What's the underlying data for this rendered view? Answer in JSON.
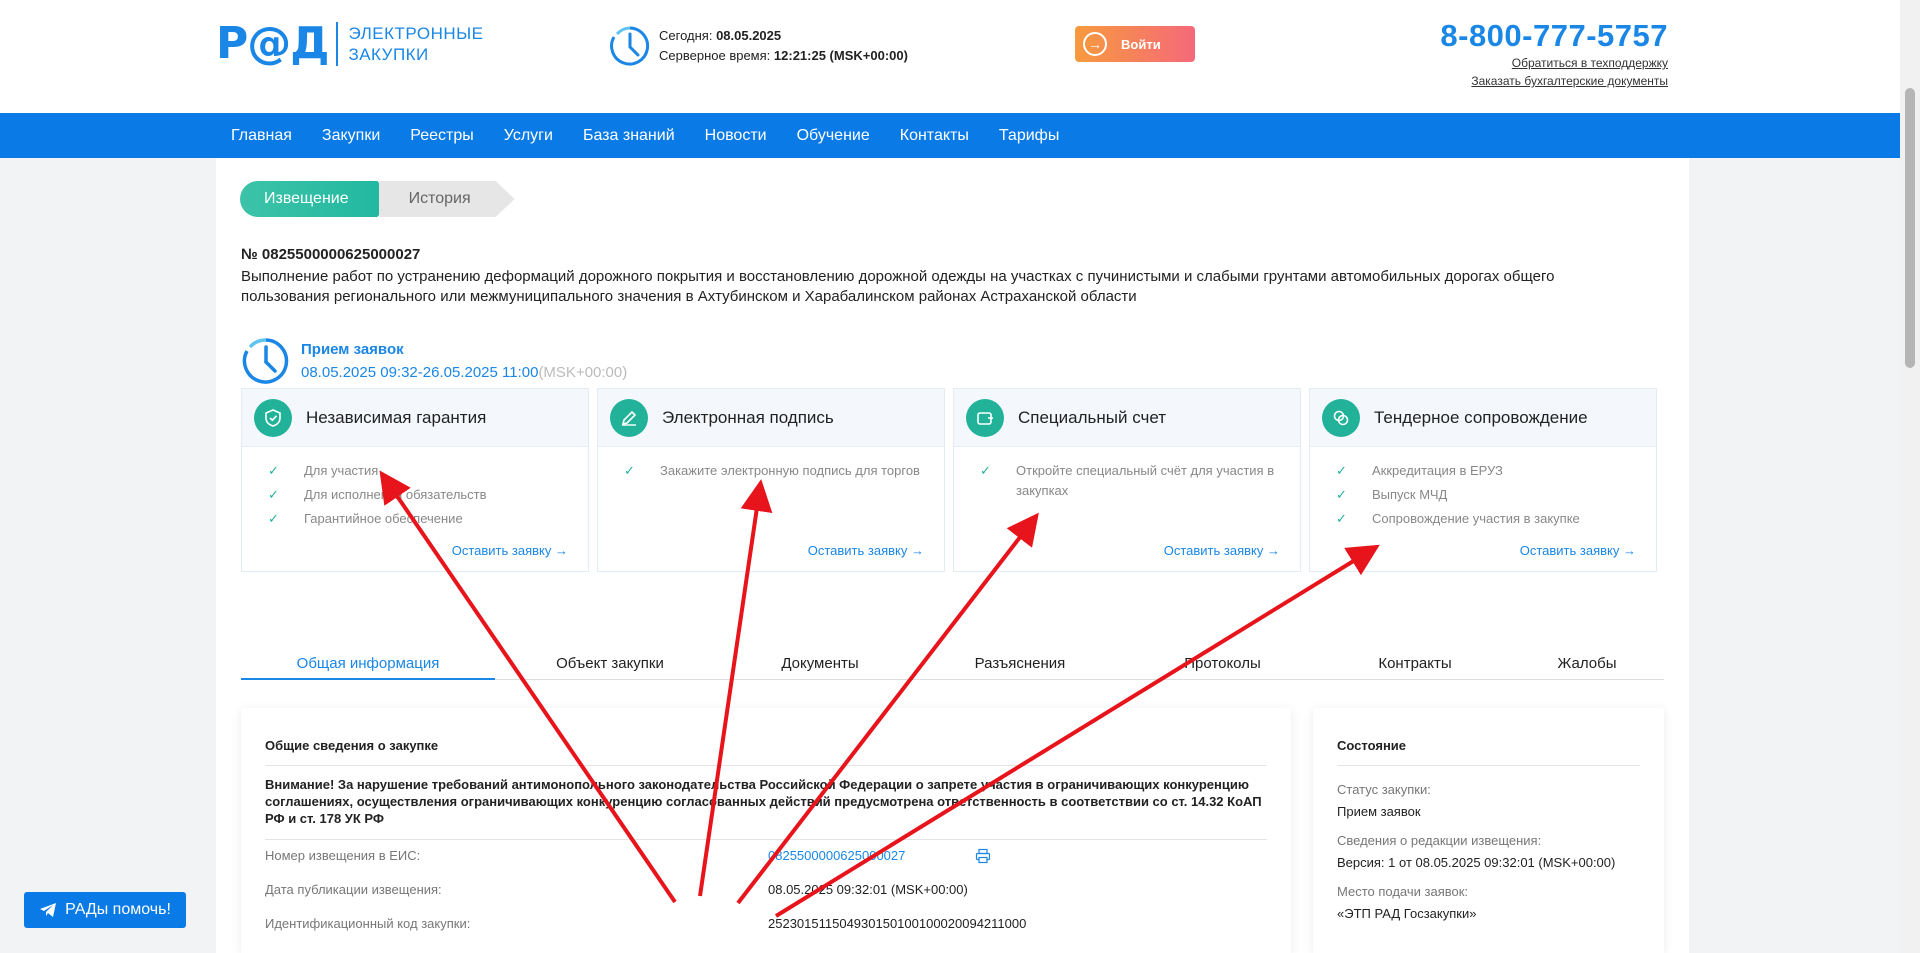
{
  "header": {
    "logo_mark": "Р@Д",
    "logo_line1": "ЭЛЕКТРОННЫЕ",
    "logo_line2": "ЗАКУПКИ",
    "today_label": "Сегодня:",
    "today_value": "08.05.2025",
    "server_label": "Серверное время:",
    "server_value": "12:21:25 (MSK+00:00)",
    "login_label": "Войти",
    "phone": "8-800-777-5757",
    "support_link": "Обратиться в техподдержку",
    "docs_link": "Заказать бухгалтерские документы"
  },
  "nav": {
    "items": [
      "Главная",
      "Закупки",
      "Реестры",
      "Услуги",
      "База знаний",
      "Новости",
      "Обучение",
      "Контакты",
      "Тарифы"
    ]
  },
  "tabs": {
    "active": "Извещение",
    "inactive": "История"
  },
  "notice": {
    "number": "№ 0825500000625000027",
    "description": "Выполнение работ по устранению деформаций дорожного покрытия и восстановлению дорожной одежды на участках с пучинистыми и слабыми грунтами автомобильных дорогах общего пользования регионального или межмуниципального значения в Ахтубинском и Харабалинском районах Астраханской области"
  },
  "stage": {
    "title": "Прием заявок",
    "range": "08.05.2025 09:32-26.05.2025 11:00",
    "tz": "(MSK+00:00)"
  },
  "services": [
    {
      "title": "Независимая гарантия",
      "items": [
        "Для участия",
        "Для исполнения обязательств",
        "Гарантийное обеспечение"
      ],
      "link": "Оставить заявку"
    },
    {
      "title": "Электронная подпись",
      "items": [
        "Закажите электронную подпись для торгов"
      ],
      "link": "Оставить заявку"
    },
    {
      "title": "Специальный счет",
      "items": [
        "Откройте специальный счёт для участия в закупках"
      ],
      "link": "Оставить заявку"
    },
    {
      "title": "Тендерное сопровождение",
      "items": [
        "Аккредитация в ЕРУЗ",
        "Выпуск МЧД",
        "Сопровождение участия в закупке"
      ],
      "link": "Оставить заявку"
    }
  ],
  "content_tabs": [
    "Общая информация",
    "Объект закупки",
    "Документы",
    "Разъяснения",
    "Протоколы",
    "Контракты",
    "Жалобы"
  ],
  "general": {
    "title": "Общие сведения о закупке",
    "warning": "Внимание! За нарушение требований антимонопольного законодательства Российской Федерации о запрете участия в ограничивающих конкуренцию соглашениях, осуществления ограничивающих конкуренцию согласованных действий предусмотрена ответственность в соответствии со ст. 14.32 КоАП РФ и ст. 178 УК РФ",
    "rows": [
      {
        "label": "Номер извещения в ЕИС:",
        "value": "0825500000625000027"
      },
      {
        "label": "Дата публикации извещения:",
        "value": "08.05.2025 09:32:01 (MSK+00:00)"
      },
      {
        "label": "Идентификационный код закупки:",
        "value": "252301511504930150100100020094211000"
      }
    ]
  },
  "state": {
    "title": "Состояние",
    "status_label": "Статус закупки:",
    "status_value": "Прием заявок",
    "edition_label": "Сведения о редакции извещения:",
    "edition_value": "Версия: 1 от 08.05.2025 09:32:01 (MSK+00:00)",
    "place_label": "Место подачи заявок:",
    "place_value": "«ЭТП РАД Госзакупки»"
  },
  "help_button": "РАДы помочь!",
  "colors": {
    "brand_blue": "#0a7ae6",
    "teal": "#22b29a",
    "login_gradient_start": "#f79a3e",
    "login_gradient_end": "#f5697a",
    "annotation_arrow": "#e8141b"
  }
}
